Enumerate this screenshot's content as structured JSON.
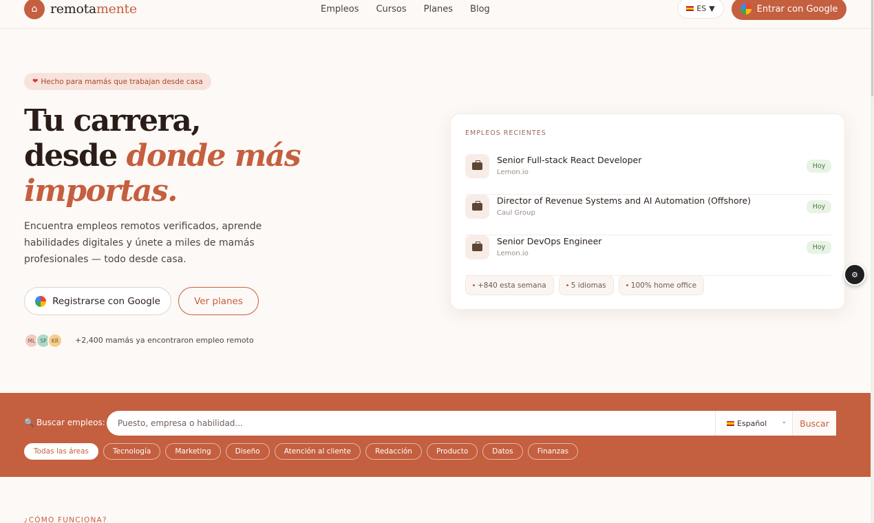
{
  "header": {
    "brand_prefix": "remota",
    "brand_suffix": "mente",
    "nav": [
      "Empleos",
      "Cursos",
      "Planes",
      "Blog"
    ],
    "lang": "ES",
    "lang_arrow": "▼",
    "cta": "Entrar con Google"
  },
  "hero": {
    "badge": "Hecho para mamás que trabajan desde casa",
    "title_line1": "Tu carrera,",
    "title_line2_plain": "desde ",
    "title_line2_em": "donde más",
    "title_line3_em": "importas.",
    "subtitle": "Encuentra empleos remotos verificados, aprende habilidades digitales y únete a miles de mamás profesionales — todo desde casa.",
    "register_button": "Registrarse con Google",
    "plans_button": "Ver planes",
    "avatars": [
      "ML",
      "SP",
      "KR"
    ],
    "social_proof": "+2,400 mamás ya encontraron empleo remoto"
  },
  "recent_jobs": {
    "label": "EMPLEOS RECIENTES",
    "jobs": [
      {
        "title": "Senior Full-stack React Developer",
        "company": "Lemon.io",
        "badge": "Hoy"
      },
      {
        "title": "Director of Revenue Systems and AI Automation (Offshore)",
        "company": "Caul Group",
        "badge": "Hoy"
      },
      {
        "title": "Senior DevOps Engineer",
        "company": "Lemon.io",
        "badge": "Hoy"
      }
    ],
    "stats": [
      "+840 esta semana",
      "5 idiomas",
      "100% home office"
    ]
  },
  "search": {
    "label": "Buscar empleos:",
    "placeholder": "Puesto, empresa o habilidad...",
    "language": "Español",
    "button": "Buscar",
    "categories": [
      "Todas las áreas",
      "Tecnología",
      "Marketing",
      "Diseño",
      "Atención al cliente",
      "Redacción",
      "Producto",
      "Datos",
      "Finanzas"
    ],
    "active_category": "Todas las áreas"
  },
  "how_it_works": {
    "label": "¿CÓMO FUNCIONA?"
  },
  "colors": {
    "brand": "#c45f3f",
    "background": "#fdf9f6"
  }
}
